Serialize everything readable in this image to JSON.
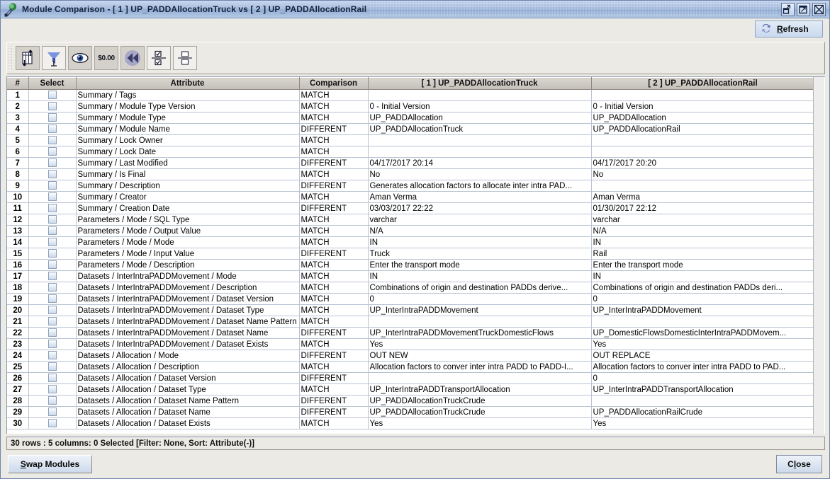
{
  "window": {
    "app_icon": "module-comparison-icon",
    "title_prefix": "Module Comparison",
    "title_sep": "-",
    "module1_tag": "[ 1 ]",
    "module1_name": "UP_PADDAllocationTruck",
    "vs": "vs",
    "module2_tag": "[ 2 ]",
    "module2_name": "UP_PADDAllocationRail",
    "full_title": "Module Comparison  -  [ 1 ] UP_PADDAllocationTruck   vs  [ 2 ] UP_PADDAllocationRail",
    "controls": [
      "restore-icon",
      "maximize-icon",
      "close-icon"
    ]
  },
  "refresh": {
    "label": "Refresh",
    "mnemonic": "R",
    "rest": "efresh",
    "icon": "refresh-circular-arrows-icon"
  },
  "toolbar": {
    "buttons": [
      {
        "name": "columns-icon",
        "tooltip": "Columns",
        "pressed": true
      },
      {
        "name": "filter-funnel-icon",
        "tooltip": "Filter",
        "pressed": false
      },
      {
        "name": "eye-view-icon",
        "tooltip": "View",
        "pressed": true
      },
      {
        "name": "currency-format-icon",
        "tooltip": "$0.00",
        "pressed": true,
        "text": "$0.00"
      },
      {
        "name": "rewind-icon",
        "tooltip": "Reset",
        "pressed": true
      },
      {
        "name": "select-all-icon",
        "tooltip": "Select All",
        "pressed": false
      },
      {
        "name": "group-split-icon",
        "tooltip": "Group",
        "pressed": false
      }
    ]
  },
  "table": {
    "columns": [
      "#",
      "Select",
      "Attribute",
      "Comparison",
      "[ 1 ] UP_PADDAllocationTruck",
      "[ 2 ] UP_PADDAllocationRail"
    ],
    "rows": [
      {
        "n": "1",
        "attr": "Summary / Tags",
        "cmp": "MATCH",
        "v1": "",
        "v2": ""
      },
      {
        "n": "2",
        "attr": "Summary / Module Type Version",
        "cmp": "MATCH",
        "v1": "0 - Initial Version",
        "v2": "0 - Initial Version"
      },
      {
        "n": "3",
        "attr": "Summary / Module Type",
        "cmp": "MATCH",
        "v1": "UP_PADDAllocation",
        "v2": "UP_PADDAllocation"
      },
      {
        "n": "4",
        "attr": "Summary / Module Name",
        "cmp": "DIFFERENT",
        "v1": "UP_PADDAllocationTruck",
        "v2": "UP_PADDAllocationRail"
      },
      {
        "n": "5",
        "attr": "Summary / Lock Owner",
        "cmp": "MATCH",
        "v1": "",
        "v2": ""
      },
      {
        "n": "6",
        "attr": "Summary / Lock Date",
        "cmp": "MATCH",
        "v1": "",
        "v2": ""
      },
      {
        "n": "7",
        "attr": "Summary / Last Modified",
        "cmp": "DIFFERENT",
        "v1": "04/17/2017 20:14",
        "v2": "04/17/2017 20:20"
      },
      {
        "n": "8",
        "attr": "Summary / Is Final",
        "cmp": "MATCH",
        "v1": "No",
        "v2": "No"
      },
      {
        "n": "9",
        "attr": "Summary / Description",
        "cmp": "DIFFERENT",
        "v1": "Generates allocation factors to allocate inter intra PAD...",
        "v2": ""
      },
      {
        "n": "10",
        "attr": "Summary / Creator",
        "cmp": "MATCH",
        "v1": "Aman Verma",
        "v2": "Aman Verma"
      },
      {
        "n": "11",
        "attr": "Summary / Creation Date",
        "cmp": "DIFFERENT",
        "v1": "03/03/2017 22:22",
        "v2": "01/30/2017 22:12"
      },
      {
        "n": "12",
        "attr": "Parameters / Mode / SQL Type",
        "cmp": "MATCH",
        "v1": "varchar",
        "v2": "varchar"
      },
      {
        "n": "13",
        "attr": "Parameters / Mode / Output Value",
        "cmp": "MATCH",
        "v1": "N/A",
        "v2": "N/A"
      },
      {
        "n": "14",
        "attr": "Parameters / Mode / Mode",
        "cmp": "MATCH",
        "v1": "IN",
        "v2": "IN"
      },
      {
        "n": "15",
        "attr": "Parameters / Mode / Input Value",
        "cmp": "DIFFERENT",
        "v1": "Truck",
        "v2": "Rail"
      },
      {
        "n": "16",
        "attr": "Parameters / Mode / Description",
        "cmp": "MATCH",
        "v1": "Enter the transport mode",
        "v2": "Enter the transport mode"
      },
      {
        "n": "17",
        "attr": "Datasets / InterIntraPADDMovement / Mode",
        "cmp": "MATCH",
        "v1": "IN",
        "v2": "IN"
      },
      {
        "n": "18",
        "attr": "Datasets / InterIntraPADDMovement / Description",
        "cmp": "MATCH",
        "v1": "Combinations of origin and destination PADDs derive...",
        "v2": "Combinations of origin and destination PADDs deri..."
      },
      {
        "n": "19",
        "attr": "Datasets / InterIntraPADDMovement / Dataset Version",
        "cmp": "MATCH",
        "v1": "0",
        "v2": "0"
      },
      {
        "n": "20",
        "attr": "Datasets / InterIntraPADDMovement / Dataset Type",
        "cmp": "MATCH",
        "v1": "UP_InterIntraPADDMovement",
        "v2": "UP_InterIntraPADDMovement"
      },
      {
        "n": "21",
        "attr": "Datasets / InterIntraPADDMovement / Dataset Name Pattern",
        "cmp": "MATCH",
        "v1": "",
        "v2": ""
      },
      {
        "n": "22",
        "attr": "Datasets / InterIntraPADDMovement / Dataset Name",
        "cmp": "DIFFERENT",
        "v1": "UP_InterIntraPADDMovementTruckDomesticFlows",
        "v2": "UP_DomesticFlowsDomesticInterIntraPADDMovem..."
      },
      {
        "n": "23",
        "attr": "Datasets / InterIntraPADDMovement / Dataset Exists",
        "cmp": "MATCH",
        "v1": "Yes",
        "v2": "Yes"
      },
      {
        "n": "24",
        "attr": "Datasets / Allocation / Mode",
        "cmp": "DIFFERENT",
        "v1": "OUT NEW",
        "v2": "OUT REPLACE"
      },
      {
        "n": "25",
        "attr": "Datasets / Allocation / Description",
        "cmp": "MATCH",
        "v1": "Allocation factors to conver inter intra PADD to PADD-I...",
        "v2": "Allocation factors to conver inter intra PADD to PAD..."
      },
      {
        "n": "26",
        "attr": "Datasets / Allocation / Dataset Version",
        "cmp": "DIFFERENT",
        "v1": "",
        "v2": "0"
      },
      {
        "n": "27",
        "attr": "Datasets / Allocation / Dataset Type",
        "cmp": "MATCH",
        "v1": "UP_InterIntraPADDTransportAllocation",
        "v2": "UP_InterIntraPADDTransportAllocation"
      },
      {
        "n": "28",
        "attr": "Datasets / Allocation / Dataset Name Pattern",
        "cmp": "DIFFERENT",
        "v1": "UP_PADDAllocationTruckCrude",
        "v2": ""
      },
      {
        "n": "29",
        "attr": "Datasets / Allocation / Dataset Name",
        "cmp": "DIFFERENT",
        "v1": "UP_PADDAllocationTruckCrude",
        "v2": "UP_PADDAllocationRailCrude"
      },
      {
        "n": "30",
        "attr": "Datasets / Allocation / Dataset Exists",
        "cmp": "MATCH",
        "v1": "Yes",
        "v2": "Yes"
      }
    ]
  },
  "statusbar": {
    "text": "30 rows : 5 columns: 0 Selected [Filter: None, Sort: Attribute(-)]"
  },
  "footer": {
    "swap_mnemonic": "S",
    "swap_rest": "wap Modules",
    "swap_label": "Swap Modules",
    "close_pre": "C",
    "close_mnemonic": "l",
    "close_post": "ose",
    "close_label": "Close"
  },
  "colors": {
    "titlebar_accent": "#a9bfdf",
    "row_number_text": "#9e5b10",
    "header_bg": "#c9c5be",
    "window_bg": "#eceae5"
  }
}
